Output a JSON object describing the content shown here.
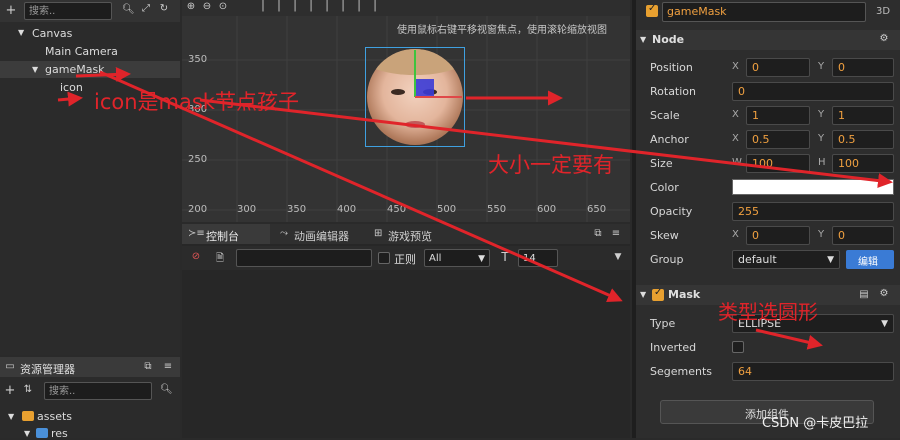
{
  "hierarchy": {
    "search_placeholder": "搜索..",
    "items": [
      {
        "label": "Canvas"
      },
      {
        "label": "Main Camera"
      },
      {
        "label": "gameMask"
      },
      {
        "label": "icon"
      }
    ]
  },
  "scene": {
    "hint": "使用鼠标右键平移视窗焦点，使用滚轮缩放视图",
    "y_labels": [
      "350",
      "300",
      "250",
      "200"
    ],
    "x_labels": [
      "250",
      "300",
      "350",
      "400",
      "450",
      "500",
      "550",
      "600",
      "650"
    ]
  },
  "console": {
    "tabs": [
      {
        "label": "控制台"
      },
      {
        "label": "动画编辑器"
      },
      {
        "label": "游戏预览"
      }
    ],
    "regex_label": "正则",
    "level_value": "All",
    "font_size_value": "14"
  },
  "assets": {
    "title": "资源管理器",
    "search_placeholder": "搜索..",
    "items": [
      {
        "label": "assets"
      },
      {
        "label": "res"
      }
    ]
  },
  "inspector": {
    "node_name": "gameMask",
    "badge_3d": "3D",
    "node_section": "Node",
    "props": {
      "position": {
        "label": "Position",
        "x": "0",
        "y": "0"
      },
      "rotation": {
        "label": "Rotation",
        "value": "0"
      },
      "scale": {
        "label": "Scale",
        "x": "1",
        "y": "1"
      },
      "anchor": {
        "label": "Anchor",
        "x": "0.5",
        "y": "0.5"
      },
      "size": {
        "label": "Size",
        "w": "100",
        "h": "100"
      },
      "color": {
        "label": "Color",
        "value": "#ffffff"
      },
      "opacity": {
        "label": "Opacity",
        "value": "255"
      },
      "skew": {
        "label": "Skew",
        "x": "0",
        "y": "0"
      },
      "group": {
        "label": "Group",
        "value": "default",
        "edit_label": "编辑"
      }
    },
    "axis_x": "X",
    "axis_y": "Y",
    "axis_w": "W",
    "axis_h": "H",
    "mask_section": "Mask",
    "mask": {
      "type_label": "Type",
      "type_value": "ELLIPSE",
      "inverted_label": "Inverted",
      "segments_label": "Segements",
      "segments_value": "64"
    },
    "add_component": "添加组件"
  },
  "annotations": {
    "icon_child": "icon是mask节点孩子",
    "size_required": "大小一定要有",
    "type_ellipse": "类型选圆形"
  },
  "watermark": "CSDN @卡皮巴拉",
  "colors": {
    "accent": "#e8a030",
    "annotation": "#e0242a",
    "field_value": "#f0a040",
    "edit_button": "#3a7bd5"
  }
}
